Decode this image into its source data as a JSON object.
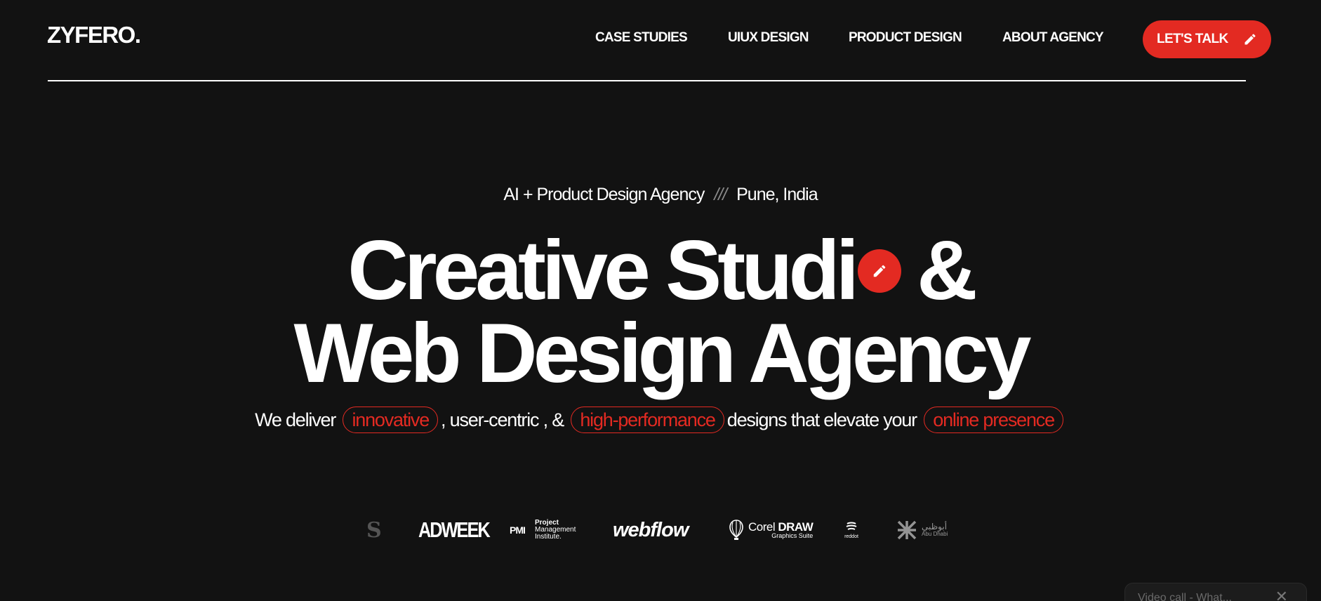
{
  "brand": {
    "logo": "ZYFERO."
  },
  "nav": {
    "items": [
      {
        "label": "CASE STUDIES"
      },
      {
        "label": "UIUX DESIGN"
      },
      {
        "label": "PRODUCT DESIGN"
      },
      {
        "label": "ABOUT AGENCY"
      }
    ],
    "cta_label": "LET'S TALK",
    "cta_icon": "pencil-icon"
  },
  "hero": {
    "eyebrow_left": "AI + Product Design Agency",
    "eyebrow_sep": "///",
    "eyebrow_right": "Pune, India",
    "line1_a": "Creative Studi",
    "line1_b": "&",
    "line2": "Web Design Agency",
    "dot_icon": "pencil-icon",
    "subline": {
      "t1": "We deliver",
      "p1": "innovative",
      "t2": ", user-centric , &",
      "p2": "high-performance",
      "t3": "designs that elevate your",
      "p3": "online presence"
    }
  },
  "clients": {
    "logos": [
      {
        "name": "s",
        "text": "S"
      },
      {
        "name": "adweek",
        "text": "ADWEEK"
      },
      {
        "name": "pmi",
        "mark": "PMI",
        "line1": "Project",
        "line2": "Management",
        "line3": "Institute."
      },
      {
        "name": "webflow",
        "text": "webflow"
      },
      {
        "name": "coreldraw",
        "text_a": "Corel",
        "text_b": "DRAW",
        "sub": "Graphics Suite"
      },
      {
        "name": "reddot",
        "text": "reddot"
      },
      {
        "name": "abu-dhabi",
        "text_ar": "أبوظبي",
        "text_en": "Abu Dhabi"
      }
    ]
  },
  "chat": {
    "text": "Video call - What...",
    "close": "✕"
  },
  "colors": {
    "background": "#121212",
    "accent": "#e32a22",
    "text": "#ffffff"
  }
}
